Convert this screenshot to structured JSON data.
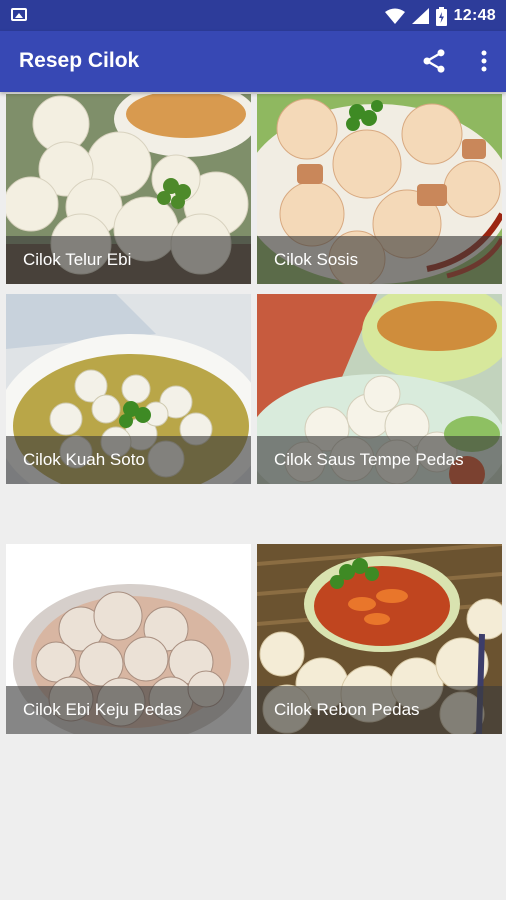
{
  "status_bar": {
    "time": "12:48",
    "icons": [
      "image-notification-icon",
      "wifi-icon",
      "signal-icon",
      "battery-icon"
    ]
  },
  "app_bar": {
    "title": "Resep Cilok",
    "actions": [
      "share-icon",
      "more-vert-icon"
    ]
  },
  "recipes": [
    {
      "label": "Cilok Telur Ebi"
    },
    {
      "label": "Cilok Sosis"
    },
    {
      "label": "Cilok Kuah Soto"
    },
    {
      "label": "Cilok Saus Tempe Pedas"
    },
    {
      "label": "Cilok Ebi Keju Pedas"
    },
    {
      "label": "Cilok Rebon Pedas"
    }
  ],
  "colors": {
    "status_bar": "#2d3c9a",
    "app_bar": "#3748b4",
    "background": "#eeeeee"
  }
}
